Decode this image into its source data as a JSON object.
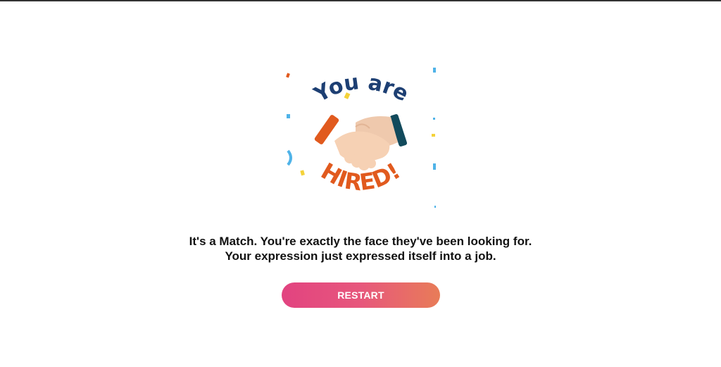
{
  "illustration": {
    "top_text": "You are",
    "bottom_text": "HIRED!",
    "colors": {
      "navy": "#1d3f73",
      "orange": "#e15a1e",
      "skin_light": "#f6d1b4",
      "skin_dark": "#efc9ad",
      "cuff_teal": "#124a5c",
      "confetti_blue": "#4fb3e8",
      "confetti_yellow": "#f4d23a"
    }
  },
  "message": {
    "line1": "It's a Match. You're exactly the face they've been looking for.",
    "line2": "Your expression just expressed itself into a job."
  },
  "restart_button": {
    "label": "RESTART",
    "gradient_start": "#e24380",
    "gradient_end": "#e87c58"
  }
}
